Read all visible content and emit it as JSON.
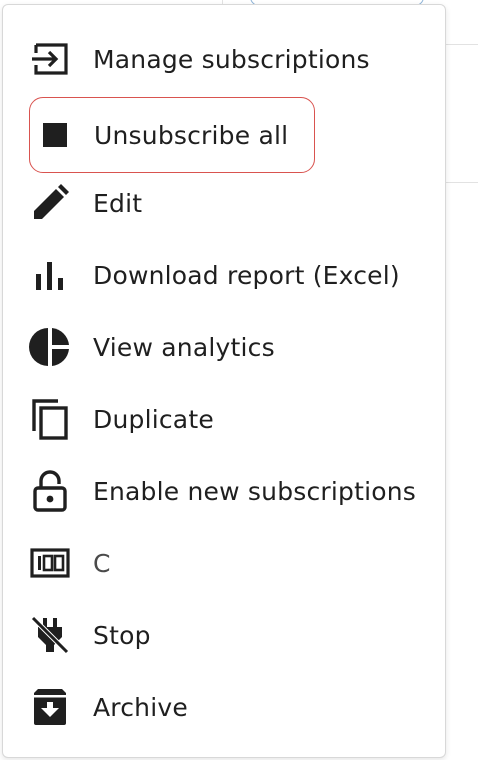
{
  "menu": {
    "items": [
      {
        "label": "Manage subscriptions",
        "icon": "sign-in-icon"
      },
      {
        "label": "Unsubscribe all",
        "icon": "stop-square-icon"
      },
      {
        "label": "Edit",
        "icon": "pencil-icon"
      },
      {
        "label": "Download report (Excel)",
        "icon": "bar-chart-icon"
      },
      {
        "label": "View analytics",
        "icon": "pie-chart-icon"
      },
      {
        "label": "Duplicate",
        "icon": "copy-icon"
      },
      {
        "label": "Enable new subscriptions",
        "icon": "lock-open-icon"
      },
      {
        "label": "C",
        "icon": "counter-100-icon"
      },
      {
        "label": "Stop",
        "icon": "power-off-icon"
      },
      {
        "label": "Archive",
        "icon": "archive-icon"
      }
    ],
    "highlight_color": "#d9534f"
  }
}
